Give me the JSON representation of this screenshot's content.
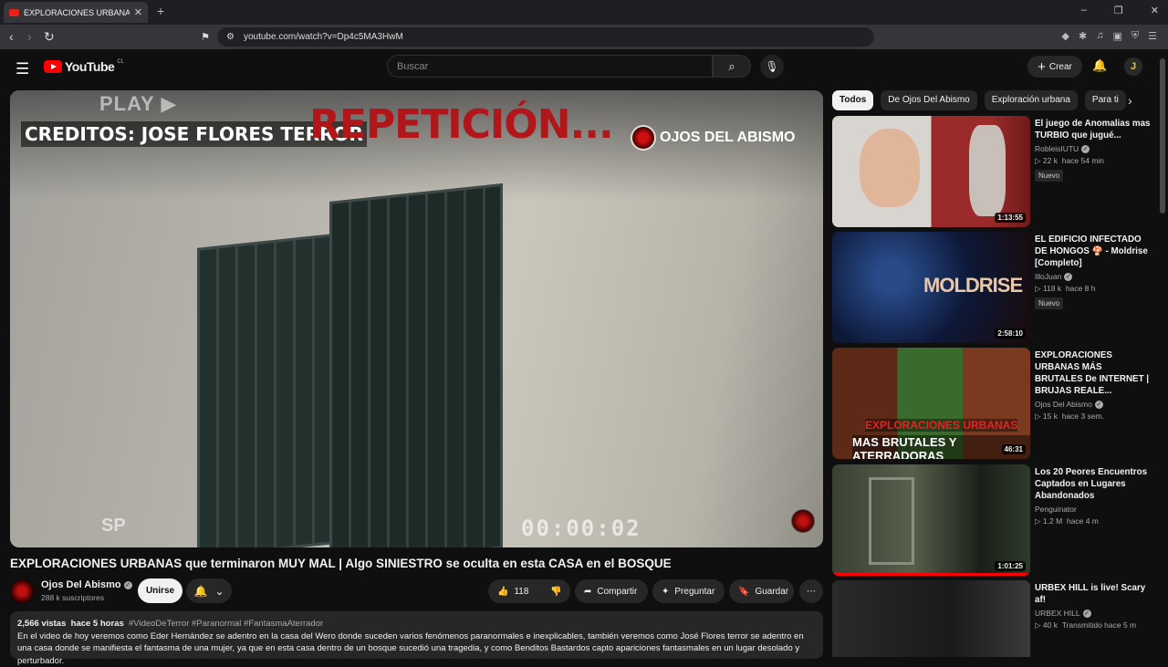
{
  "browser": {
    "tab_title": "EXPLORACIONES URBANAS",
    "tab_close": "✕",
    "new_tab": "+",
    "url": "youtube.com/watch?v=Dp4c5MA3HwM"
  },
  "header": {
    "logo_text": "YouTube",
    "country": "CL",
    "search_placeholder": "Buscar",
    "create_label": "Crear",
    "avatar_letter": "J"
  },
  "player": {
    "overlay_play": "PLAY ▶",
    "overlay_credits": "CREDITOS: JOSE FLORES TERROR",
    "overlay_repeat": "REPETICIÓN...",
    "overlay_channel": "OJOS DEL ABISMO",
    "overlay_sp": "SP",
    "overlay_time": "00:00:02"
  },
  "video": {
    "title": "EXPLORACIONES URBANAS que terminaron MUY MAL | Algo SINIESTRO se oculta en esta CASA en el BOSQUE",
    "channel": "Ojos Del Abismo",
    "subscribers": "288 k suscriptores",
    "join_label": "Unirse",
    "likes": "118",
    "share_label": "Compartir",
    "ask_label": "Preguntar",
    "save_label": "Guardar",
    "views": "2,566 vistas",
    "age": "hace 5 horas",
    "tags": "#VideoDeTerror #Paranormal #FantasmaAterrador",
    "description": "En el video de hoy veremos como Eder Hernández se adentro en la casa del Wero donde suceden varios fenómenos paranormales e inexplicables, también veremos como José Flores terror se adentro en una casa donde se manifiesta el fantasma de una mujer, ya que en esta casa dentro de un bosque sucedió una tragedia, y como Benditos Bastardos capto apariciones fantasmales en un lugar desolado y perturbador."
  },
  "chips": [
    "Todos",
    "De Ojos Del Abismo",
    "Exploración urbana",
    "Para ti"
  ],
  "recommendations": [
    {
      "title": "El juego de Anomalias mas TURBIO que jugué...",
      "channel": "RobleisIUTU",
      "views": "22 k",
      "age": "hace 54 min",
      "badge": "Nuevo",
      "duration": "1:13:55"
    },
    {
      "title": "EL EDIFICIO INFECTADO DE HONGOS 🍄 - Moldrise [Completo]",
      "channel": "IlloJuan",
      "views": "118 k",
      "age": "hace 8 h",
      "badge": "Nuevo",
      "duration": "2:58:10",
      "thumb_text": "MOLDRISE"
    },
    {
      "title": "EXPLORACIONES URBANAS MÁS BRUTALES De INTERNET | BRUJAS REALE...",
      "channel": "Ojos Del Abismo",
      "views": "15 k",
      "age": "hace 3 sem.",
      "duration": "46:31",
      "thumb_line1": "EXPLORACIONES URBANAS",
      "thumb_line2": "MAS BRUTALES Y ATERRADORAS"
    },
    {
      "title": "Los 20 Peores Encuentros Captados en Lugares Abandonados",
      "channel": "Penguinator",
      "views": "1.2 M",
      "age": "hace 4 m",
      "duration": "1:01:25"
    },
    {
      "title": "URBEX HILL is live! Scary af!",
      "channel": "URBEX HILL",
      "views": "40 k",
      "age": "Transmitido hace 5 m"
    }
  ],
  "colors": {
    "accent": "#ff0000",
    "bg": "#0f0f0f",
    "surface": "#272727"
  }
}
